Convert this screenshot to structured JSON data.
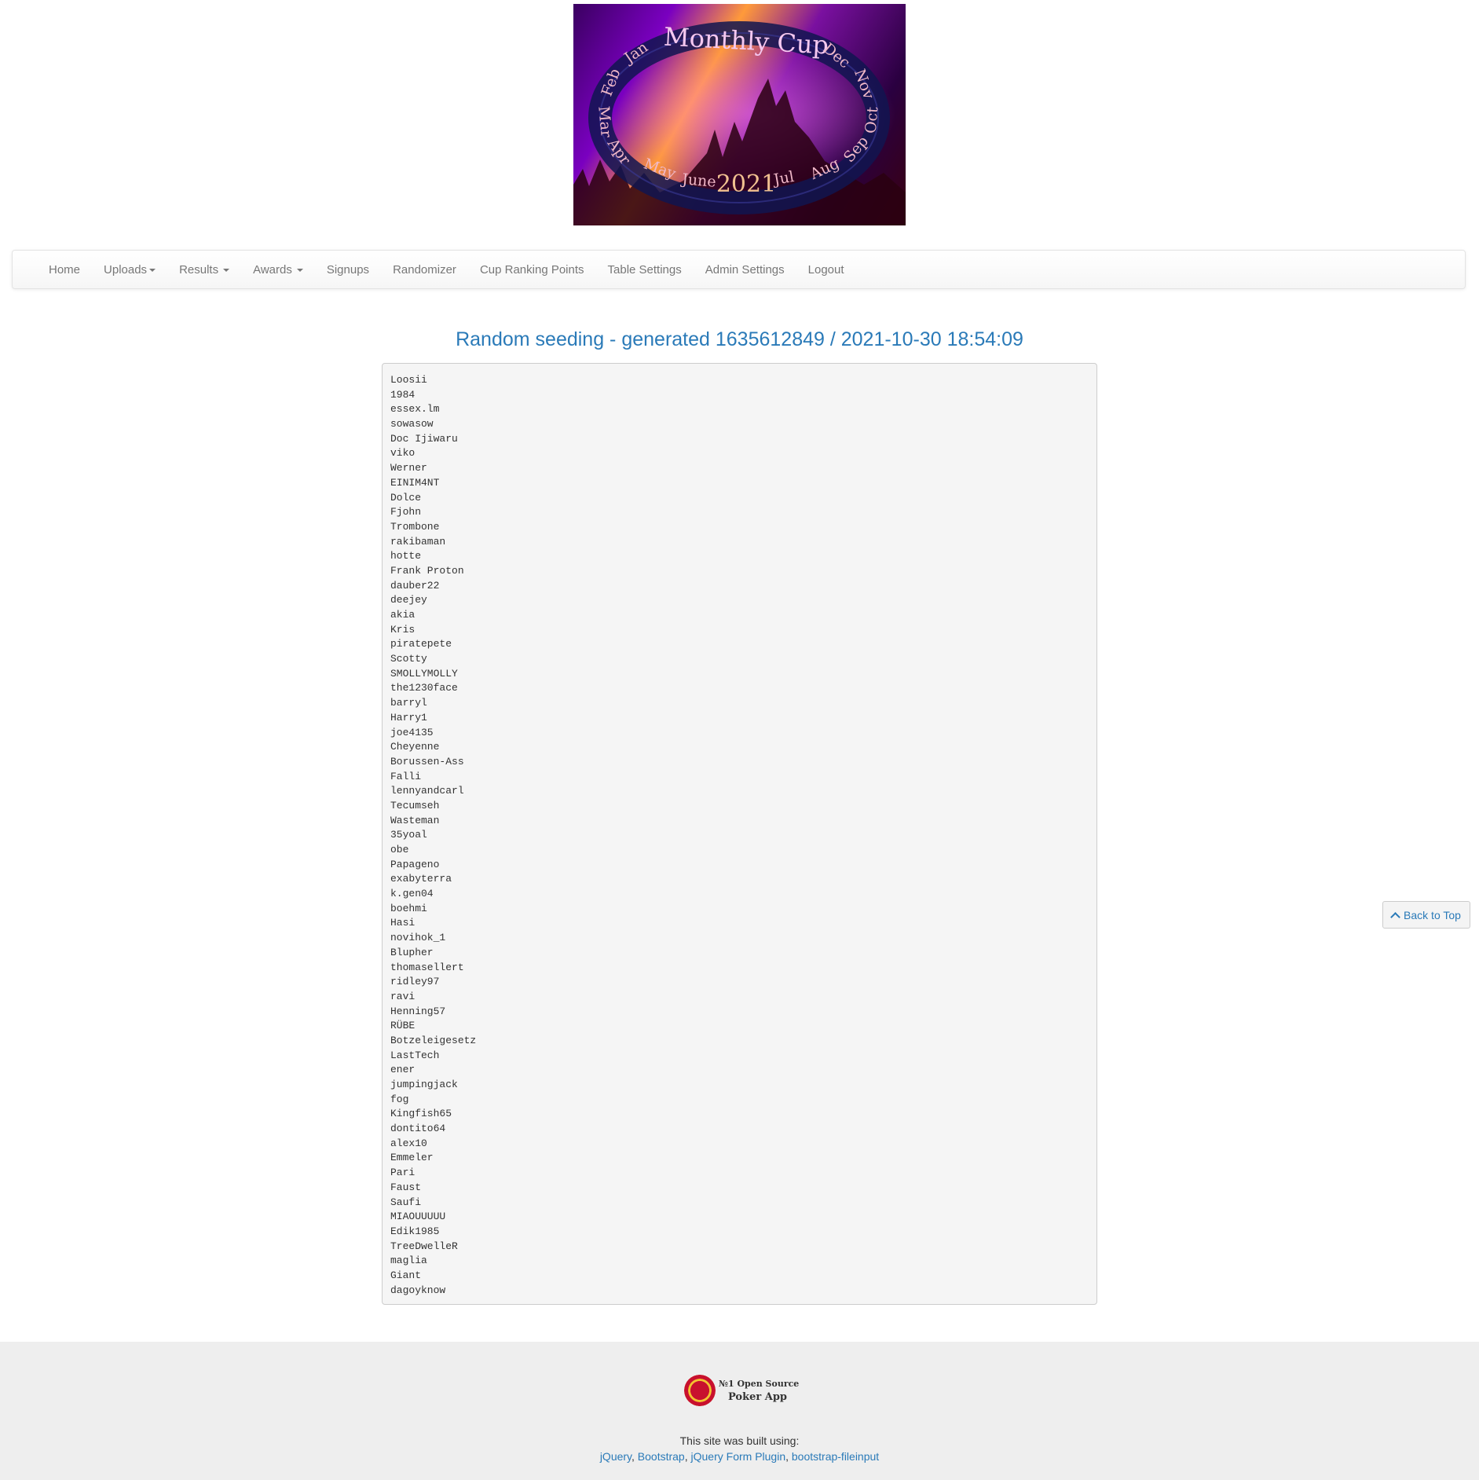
{
  "banner": {
    "title": "Monthly Cup",
    "year": "2021",
    "months": [
      "Jan",
      "Feb",
      "Mar",
      "Apr",
      "May",
      "June",
      "Jul",
      "Aug",
      "Sep",
      "Oct",
      "Nov",
      "Dec"
    ]
  },
  "nav": {
    "items": [
      {
        "label": "Home",
        "dropdown": false
      },
      {
        "label": "Uploads",
        "dropdown": true
      },
      {
        "label": "Results",
        "dropdown": true
      },
      {
        "label": "Awards",
        "dropdown": true
      },
      {
        "label": "Signups",
        "dropdown": false
      },
      {
        "label": "Randomizer",
        "dropdown": false
      },
      {
        "label": "Cup Ranking Points",
        "dropdown": false
      },
      {
        "label": "Table Settings",
        "dropdown": false
      },
      {
        "label": "Admin Settings",
        "dropdown": false
      },
      {
        "label": "Logout",
        "dropdown": false
      }
    ]
  },
  "main": {
    "title": "Random seeding - generated 1635612849 / 2021-10-30 18:54:09",
    "players": [
      "Loosii",
      "1984",
      "essex.lm",
      "sowasow",
      "Doc Ijiwaru",
      "viko",
      "Werner",
      "EINIM4NT",
      "Dolce",
      "Fjohn",
      "Trombone",
      "rakibaman",
      "hotte",
      "Frank Proton",
      "dauber22",
      "deejey",
      "akia",
      "Kris",
      "piratepete",
      "Scotty",
      "SMOLLYMOLLY",
      "the1230face",
      "barryl",
      "Harry1",
      "joe4135",
      "Cheyenne",
      "Borussen-Ass",
      "Falli",
      "lennyandcarl",
      "Tecumseh",
      "Wasteman",
      "35yoal",
      "obe",
      "Papageno",
      "exabyterra",
      "k.gen04",
      "boehmi",
      "Hasi",
      "novihok_1",
      "Blupher",
      "thomasellert",
      "ridley97",
      "ravi",
      "Henning57",
      "RÜBE",
      "Botzeleigesetz",
      "LastTech",
      "ener",
      "jumpingjack",
      "fog",
      "Kingfish65",
      "dontito64",
      "alex10",
      "Emmeler",
      "Pari",
      "Faust",
      "Saufi",
      "MIAOUUUUU",
      "Edik1985",
      "TreeDwelleR",
      "maglia",
      "Giant",
      "dagoyknow"
    ]
  },
  "back_to_top": {
    "label": "Back to Top",
    "icon": "chevron-up-icon"
  },
  "footer": {
    "logo_line1": "№1 Open Source",
    "logo_line2": "Poker App",
    "built_text": "This site was built using:",
    "links": [
      "jQuery",
      "Bootstrap",
      "jQuery Form Plugin",
      "bootstrap-fileinput"
    ]
  }
}
